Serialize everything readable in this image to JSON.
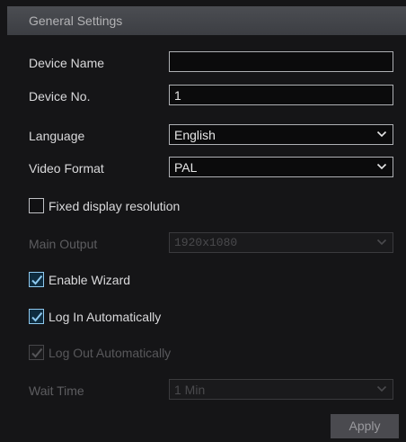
{
  "header": {
    "title": "General Settings"
  },
  "fields": {
    "device_name": {
      "label": "Device Name",
      "value": ""
    },
    "device_no": {
      "label": "Device No.",
      "value": "1"
    },
    "language": {
      "label": "Language",
      "value": "English"
    },
    "video_format": {
      "label": "Video Format",
      "value": "PAL"
    },
    "main_output": {
      "label": "Main Output",
      "value": "1920x1080",
      "enabled": false
    },
    "wait_time": {
      "label": "Wait Time",
      "value": "1 Min",
      "enabled": false
    }
  },
  "checkboxes": {
    "fixed_display_resolution": {
      "label": "Fixed display resolution",
      "checked": false,
      "enabled": true
    },
    "enable_wizard": {
      "label": "Enable Wizard",
      "checked": true,
      "enabled": true
    },
    "log_in_automatically": {
      "label": "Log In Automatically",
      "checked": true,
      "enabled": true
    },
    "log_out_automatically": {
      "label": "Log Out Automatically",
      "checked": true,
      "enabled": false
    }
  },
  "footer": {
    "apply_label": "Apply"
  },
  "colors": {
    "background": "#151517",
    "header": "#45474c",
    "accent_check": "#8ec9ef"
  }
}
